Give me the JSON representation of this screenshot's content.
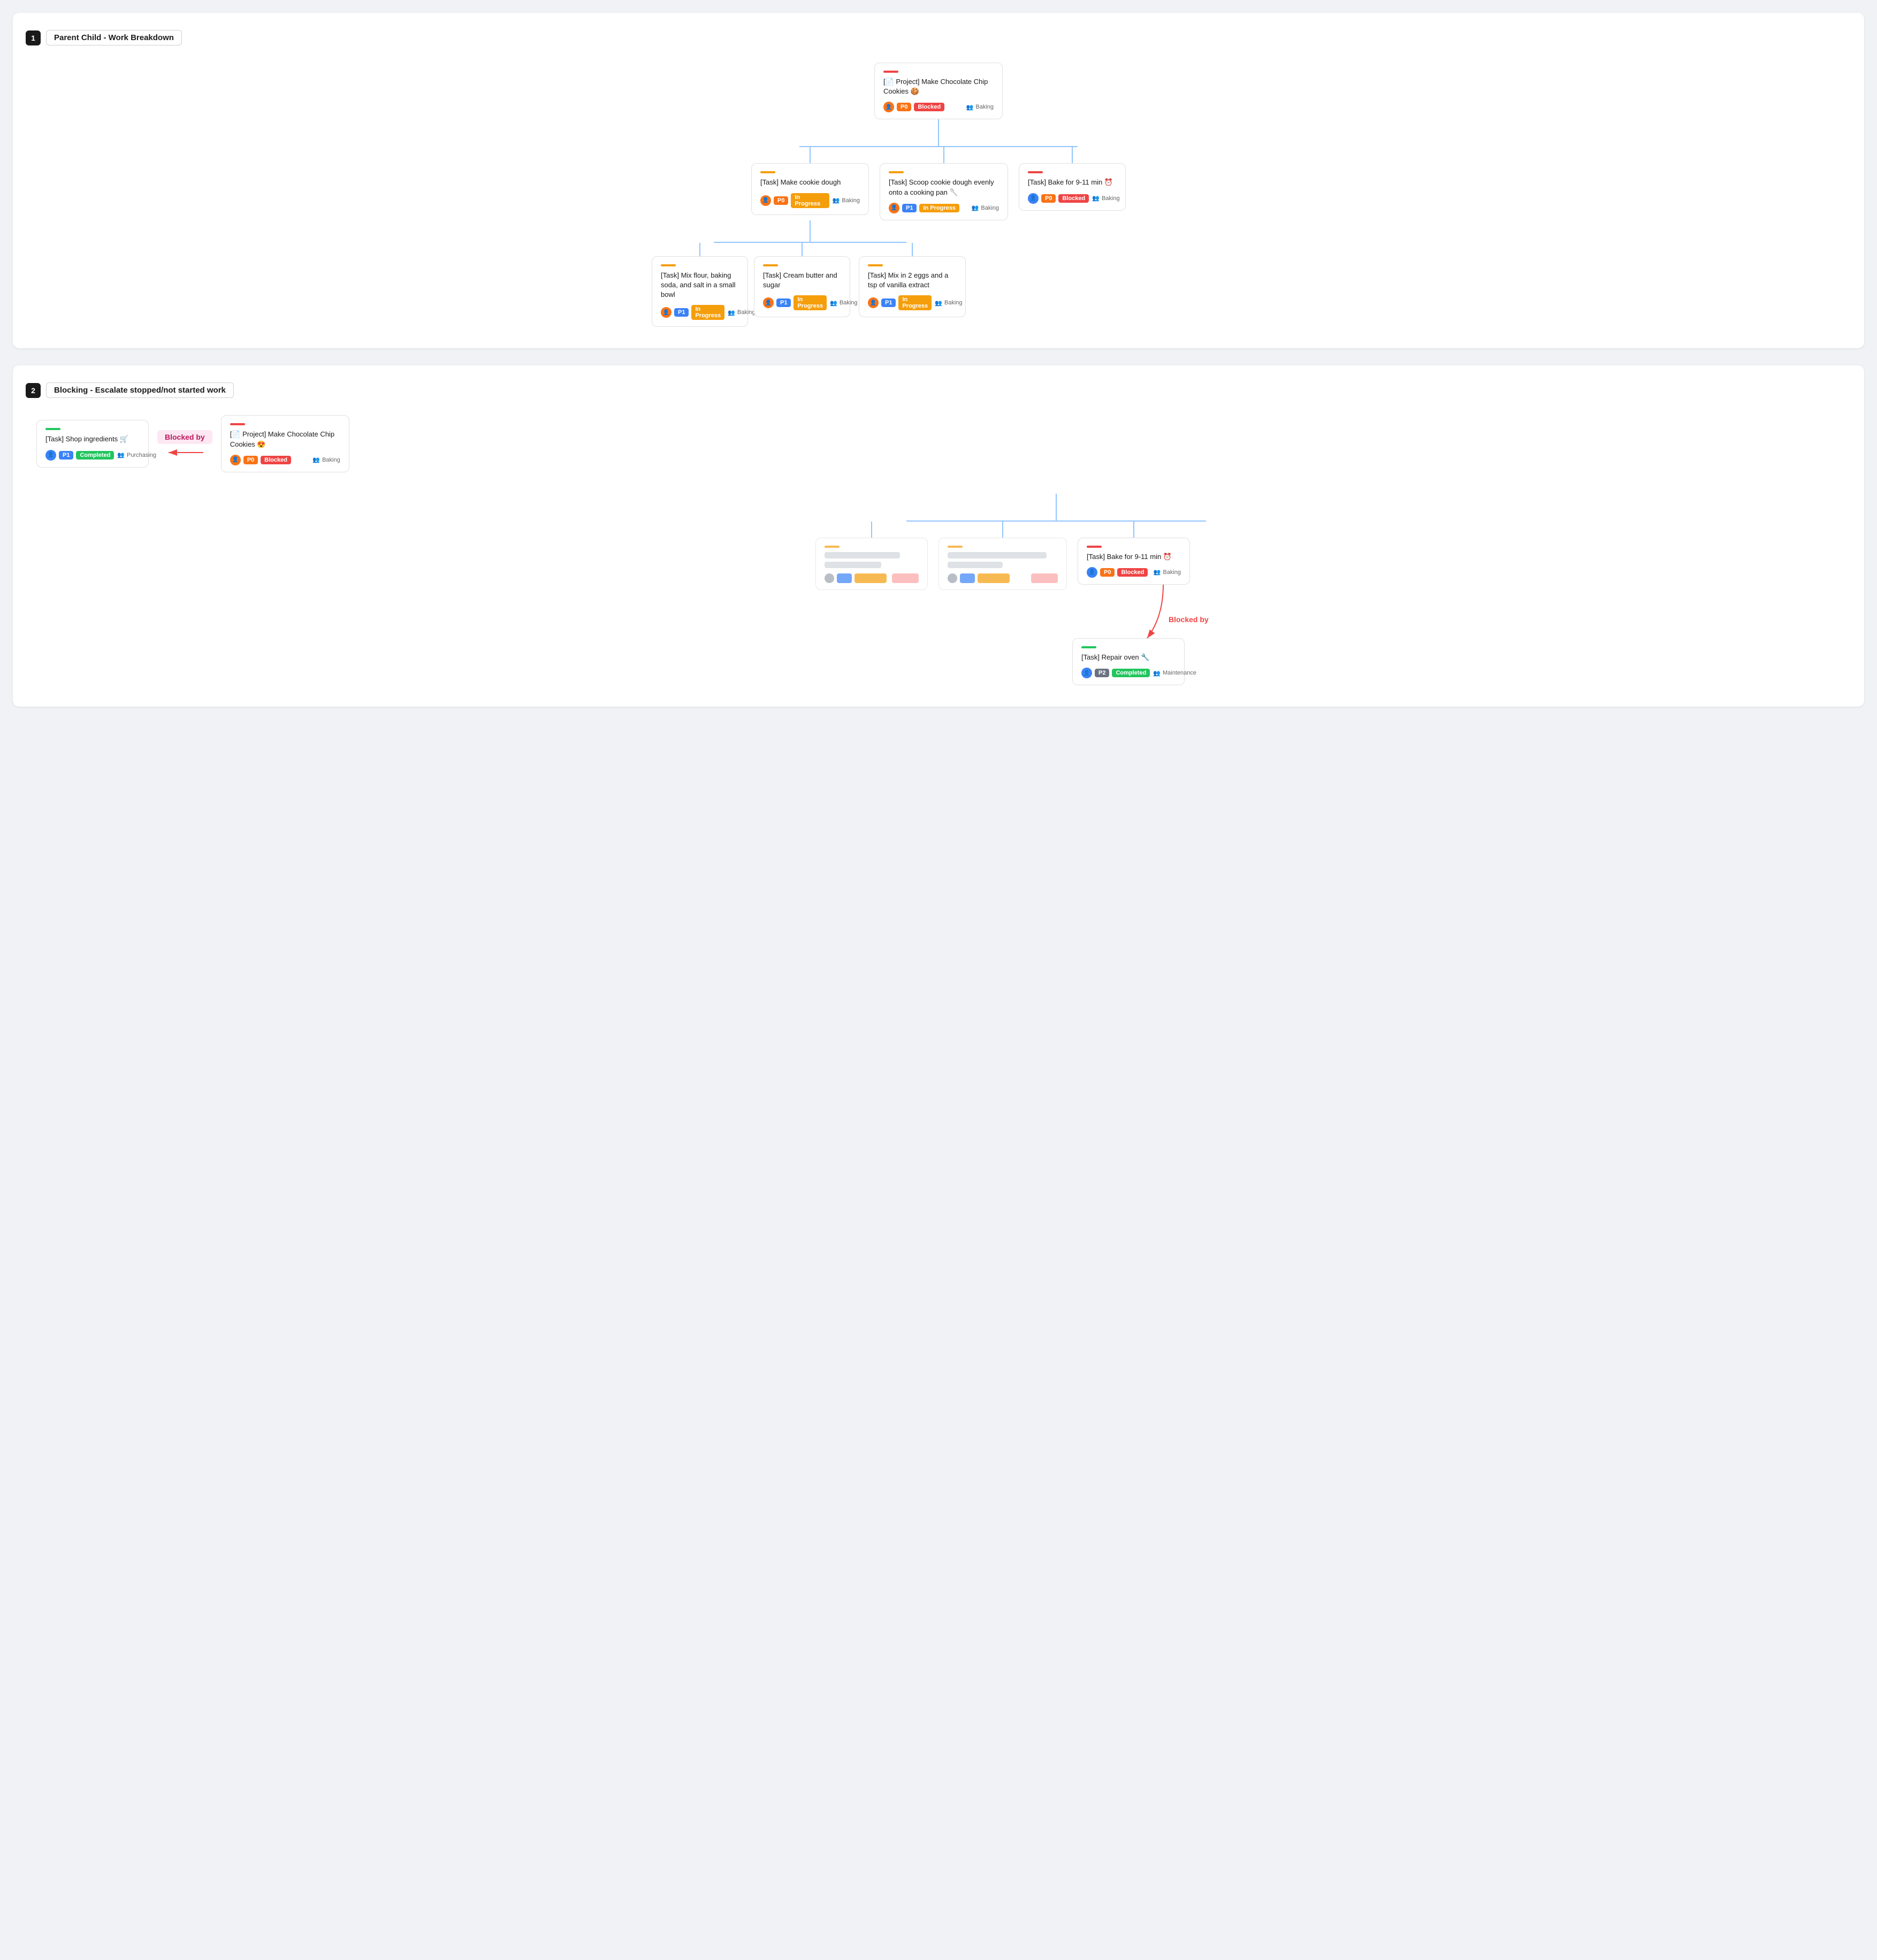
{
  "section1": {
    "number": "1",
    "title": "Parent Child - Work Breakdown",
    "root": {
      "accent": "#ef4444",
      "title": "[📄 Project] Make Chocolate Chip Cookies 🍪",
      "priority": "P0",
      "status": "Blocked",
      "status_class": "badge-blocked",
      "team": "Baking",
      "avatar_color": "#f97316"
    },
    "level2": [
      {
        "accent": "#f59e0b",
        "title": "[Task] Make cookie dough",
        "priority": "P0",
        "status": "In Progress",
        "status_class": "badge-in-progress",
        "team": "Baking",
        "avatar_color": "#f97316"
      },
      {
        "accent": "#f59e0b",
        "title": "[Task] Scoop cookie dough evenly onto a cooking pan 🥄",
        "priority": "P1",
        "status": "In Progress",
        "status_class": "badge-in-progress",
        "team": "Baking",
        "avatar_color": "#f97316"
      },
      {
        "accent": "#ef4444",
        "title": "[Task] Bake for 9-11 min ⏰",
        "priority": "P0",
        "status": "Blocked",
        "status_class": "badge-blocked",
        "team": "Baking",
        "avatar_color": "#3b82f6"
      }
    ],
    "level3": [
      {
        "accent": "#f59e0b",
        "title": "[Task] Mix flour, baking soda, and salt in a small bowl",
        "priority": "P1",
        "status": "In Progress",
        "status_class": "badge-in-progress",
        "team": "Baking",
        "avatar_color": "#f97316"
      },
      {
        "accent": "#f59e0b",
        "title": "[Task] Cream butter and sugar",
        "priority": "P1",
        "status": "In Progress",
        "status_class": "badge-in-progress",
        "team": "Baking",
        "avatar_color": "#f97316"
      },
      {
        "accent": "#f59e0b",
        "title": "[Task] Mix in 2 eggs and a tsp of vanilla extract",
        "priority": "P1",
        "status": "In Progress",
        "status_class": "badge-in-progress",
        "team": "Baking",
        "avatar_color": "#f97316"
      }
    ]
  },
  "section2": {
    "number": "2",
    "title": "Blocking - Escalate stopped/not started work",
    "shop": {
      "accent": "#22c55e",
      "title": "[Task] Shop ingredients 🛒",
      "priority": "P1",
      "status": "Completed",
      "status_class": "badge-completed",
      "team": "Purchasing",
      "avatar_color": "#3b82f6"
    },
    "blocked_by_label": "Blocked by",
    "root": {
      "accent": "#ef4444",
      "title": "[📄 Project] Make Chocolate Chip Cookies 😍",
      "priority": "P0",
      "status": "Blocked",
      "status_class": "badge-blocked",
      "team": "Baking",
      "avatar_color": "#f97316"
    },
    "level2_blurred": [
      {
        "accent": "#f59e0b"
      },
      {
        "accent": "#f59e0b"
      }
    ],
    "bake_task": {
      "accent": "#ef4444",
      "title": "[Task] Bake for 9-11 min ⏰",
      "priority": "P0",
      "status": "Blocked",
      "status_class": "badge-blocked",
      "team": "Baking",
      "avatar_color": "#3b82f6"
    },
    "blocked_by_label2": "Blocked by",
    "repair": {
      "accent": "#22c55e",
      "title": "[Task] Repair oven 🔧",
      "priority": "P2",
      "status": "Completed",
      "status_class": "badge-completed",
      "team": "Maintenance",
      "avatar_color": "#3b82f6"
    }
  },
  "icons": {
    "team": "👥",
    "avatar_person": "👤"
  }
}
